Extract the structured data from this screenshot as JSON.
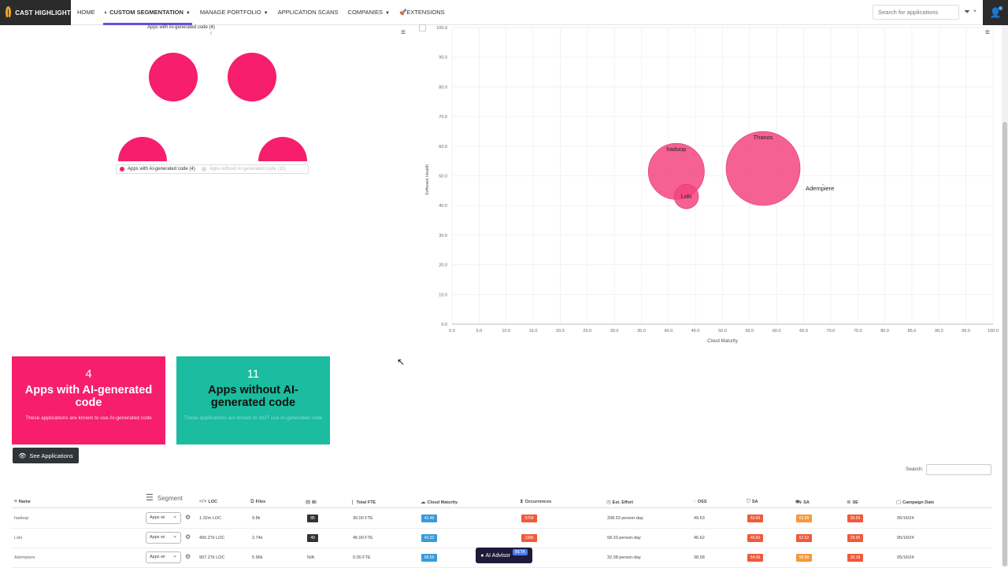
{
  "header": {
    "logo_text": "CAST HIGHLIGHT",
    "nav": [
      {
        "label": "HOME",
        "active": false,
        "dropdown": false
      },
      {
        "label": "CUSTOM SEGMENTATION",
        "active": true,
        "dropdown": true
      },
      {
        "label": "MANAGE PORTFOLIO",
        "active": false,
        "dropdown": true
      },
      {
        "label": "APPLICATION SCANS",
        "active": false,
        "dropdown": false
      },
      {
        "label": "COMPANIES",
        "active": false,
        "dropdown": true
      },
      {
        "label": "EXTENSIONS",
        "active": false,
        "dropdown": false
      }
    ],
    "search_placeholder": "Search for applications"
  },
  "pie_chart": {
    "title": "Apps with AI-generated code (4)",
    "legend": [
      {
        "label": "Apps with AI-generated code (4)",
        "color": "#f61e6d"
      },
      {
        "label": "Apps without AI-generated code (11)",
        "color": "#cccccc"
      }
    ],
    "color": "#f61e6d"
  },
  "chart_data": {
    "type": "scatter",
    "title": "",
    "xlabel": "Cloud Maturity",
    "ylabel": "Software Health",
    "xlim": [
      0,
      100
    ],
    "ylim": [
      0,
      100
    ],
    "x_ticks": [
      "0.0",
      "5.0",
      "10.0",
      "15.0",
      "20.0",
      "25.0",
      "30.0",
      "35.0",
      "40.0",
      "45.0",
      "50.0",
      "55.0",
      "60.0",
      "65.0",
      "70.0",
      "75.0",
      "80.0",
      "85.0",
      "90.0",
      "95.0",
      "100.0"
    ],
    "y_ticks": [
      "0.0",
      "10.0",
      "20.0",
      "30.0",
      "40.0",
      "50.0",
      "60.0",
      "70.0",
      "80.0",
      "90.0",
      "100.0"
    ],
    "grid": true,
    "points": [
      {
        "label": "hadoop",
        "x": 41.46,
        "y": 51.5,
        "size": 1.32,
        "color": "#f2457f"
      },
      {
        "label": "Loki",
        "x": 43.32,
        "y": 43.0,
        "size": 0.25,
        "color": "#f2457f"
      },
      {
        "label": "Thanos",
        "x": 57.5,
        "y": 52.5,
        "size": 2.3,
        "color": "#f2457f"
      },
      {
        "label": "Adempiere",
        "x": 68.56,
        "y": 47.0,
        "size": 0.0,
        "color": "#999999"
      }
    ]
  },
  "cards": {
    "with_ai": {
      "count": "4",
      "title": "Apps with AI-generated code",
      "subtitle": "These applications are known to use AI-generated code"
    },
    "without_ai": {
      "count": "11",
      "title": "Apps without AI-generated code",
      "subtitle": "These applications are known to NOT use AI-generated code"
    }
  },
  "see_button": "See Applications",
  "table": {
    "search_label": "Search:",
    "headers": {
      "name": "Name",
      "segment": "Segment",
      "loc": "LOC",
      "files": "Files",
      "bi": "BI",
      "fte": "Total FTE",
      "cloud": "Cloud Maturity",
      "occ": "Occurrences",
      "effort": "Est. Effort",
      "oss": "OSS",
      "sa": "SA",
      "sa2": "SA",
      "se": "SE",
      "date": "Campaign Date"
    },
    "rows": [
      {
        "name": "hadoop",
        "segment": "Apps wi",
        "loc": "1.32m LOC",
        "files": "9.8k",
        "bi": "85",
        "fte": "30.00 FTE",
        "cloud": "41.46",
        "occ": "9709",
        "effort": "338.53 person-day",
        "oss": "49.53",
        "sa": "53.66",
        "sa2": "63.98",
        "se": "30.59",
        "date": "05/16/24"
      },
      {
        "name": "Loki",
        "segment": "Apps wi",
        "loc": "406.27k LOC",
        "files": "2.74k",
        "bi": "49",
        "fte": "45.00 FTE",
        "cloud": "43.32",
        "occ": "1986",
        "effort": "58.33 person-day",
        "oss": "46.62",
        "sa": "46.82",
        "sa2": "52.52",
        "se": "29.95",
        "date": "05/16/24"
      },
      {
        "name": "Adempiere",
        "segment": "Apps wi",
        "loc": "907.27k LOC",
        "files": "5.96k",
        "bi": "N/A",
        "fte": "0.00 FTE",
        "cloud": "68.56",
        "occ": "",
        "effort": "32.08 person-day",
        "oss": "38.58",
        "sa": "54.36",
        "sa2": "58.90",
        "se": "30.18",
        "date": "05/16/24"
      }
    ]
  },
  "advisor": {
    "label": "AI Advisor",
    "badge": "BETA"
  }
}
